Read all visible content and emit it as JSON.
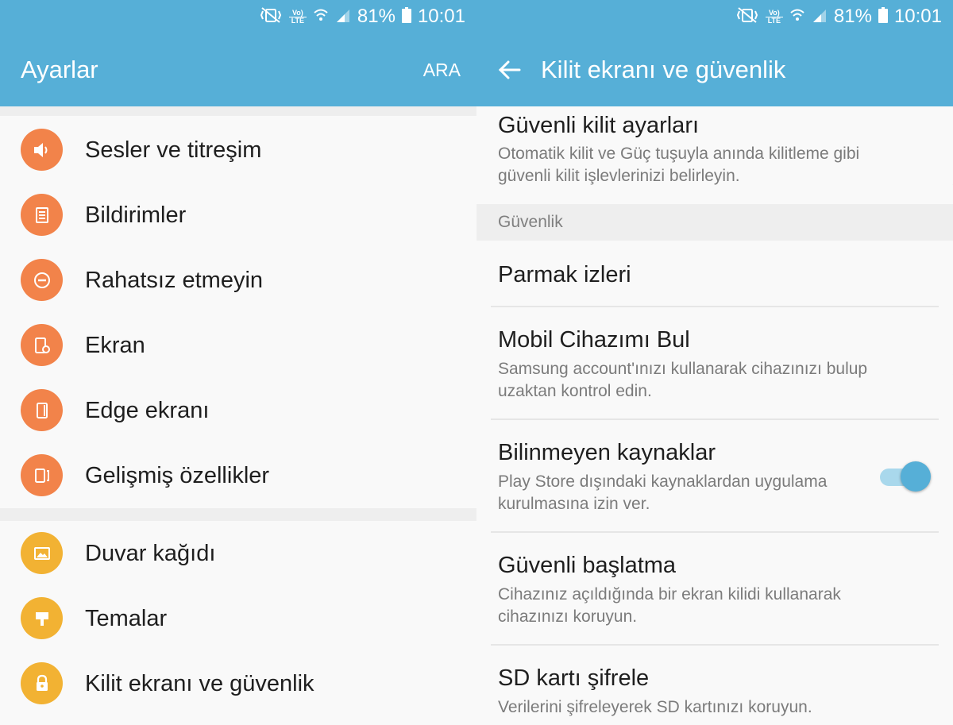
{
  "status_bar": {
    "lte_top": "Vo)",
    "lte_bottom": "LTE",
    "battery": "81%",
    "time": "10:01"
  },
  "left": {
    "title": "Ayarlar",
    "search_label": "ARA",
    "items": [
      {
        "label": "Sesler ve titreşim",
        "icon": "speaker-icon",
        "color": "#f2834a"
      },
      {
        "label": "Bildirimler",
        "icon": "notification-icon",
        "color": "#f2834a"
      },
      {
        "label": "Rahatsız etmeyin",
        "icon": "do-not-disturb-icon",
        "color": "#f2834a"
      },
      {
        "label": "Ekran",
        "icon": "display-settings-icon",
        "color": "#f2834a"
      },
      {
        "label": "Edge ekranı",
        "icon": "edge-screen-icon",
        "color": "#f2834a"
      },
      {
        "label": "Gelişmiş özellikler",
        "icon": "advanced-features-icon",
        "color": "#f2834a"
      },
      {
        "label": "Duvar kağıdı",
        "icon": "wallpaper-icon",
        "color": "#f2b233"
      },
      {
        "label": "Temalar",
        "icon": "themes-brush-icon",
        "color": "#f2b233"
      },
      {
        "label": "Kilit ekranı ve güvenlik",
        "icon": "lock-icon",
        "color": "#f2b233"
      }
    ]
  },
  "right": {
    "title": "Kilit ekranı ve güvenlik",
    "secure_lock": {
      "title": "Güvenli kilit ayarları",
      "subtitle_1": "Otomatik kilit ve Güç tuşuyla anında kilitleme gibi",
      "subtitle_2": "güvenli kilit işlevlerinizi belirleyin."
    },
    "section_security": "Güvenlik",
    "fingerprints": {
      "title": "Parmak izleri"
    },
    "find_my_mobile": {
      "title": "Mobil Cihazımı Bul",
      "subtitle_1": "Samsung account'ınızı kullanarak cihazınızı bulup",
      "subtitle_2": "uzaktan kontrol edin."
    },
    "unknown_sources": {
      "title": "Bilinmeyen kaynaklar",
      "subtitle_1": "Play Store dışındaki kaynaklardan uygulama",
      "subtitle_2": "kurulmasına izin ver.",
      "toggle_on": true
    },
    "secure_startup": {
      "title": "Güvenli başlatma",
      "subtitle_1": "Cihazınız açıldığında bir ekran kilidi kullanarak",
      "subtitle_2": "cihazınızı koruyun."
    },
    "encrypt_sd": {
      "title": "SD kartı şifrele",
      "subtitle_1": "Verilerini şifreleyerek SD kartınızı koruyun."
    }
  },
  "colors": {
    "app_bar": "#56afd7",
    "accent_orange": "#f2834a",
    "accent_yellow": "#f2b233",
    "toggle_on": "#56afd7"
  }
}
